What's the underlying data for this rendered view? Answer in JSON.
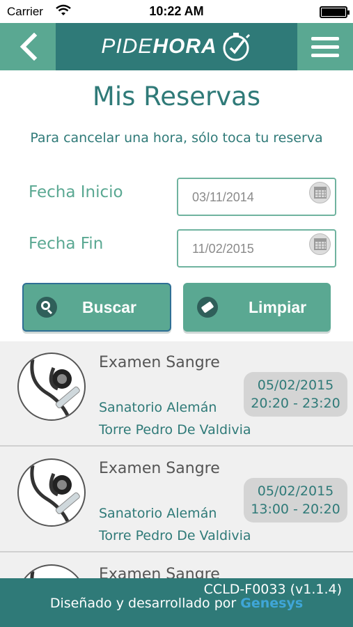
{
  "status_bar": {
    "carrier": "Carrier",
    "time": "10:22 AM"
  },
  "navbar": {
    "logo_part1": "PIDE",
    "logo_part2": "HORA"
  },
  "page": {
    "title": "Mis Reservas",
    "instruction": "Para cancelar una hora, sólo toca tu reserva"
  },
  "form": {
    "start_label": "Fecha Inicio",
    "start_value": "03/11/2014",
    "end_label": "Fecha Fin",
    "end_value": "11/02/2015"
  },
  "buttons": {
    "search": "Buscar",
    "clear": "Limpiar"
  },
  "reservations": [
    {
      "title": "Examen Sangre",
      "place": "Sanatorio Alemán",
      "branch": "Torre Pedro De Valdivia",
      "date": "05/02/2015",
      "time": "20:20 - 23:20"
    },
    {
      "title": "Examen Sangre",
      "place": "Sanatorio Alemán",
      "branch": "Torre Pedro De Valdivia",
      "date": "05/02/2015",
      "time": "13:00 - 20:20"
    },
    {
      "title": "Examen Sangre"
    }
  ],
  "footer": {
    "version": "CCLD-F0033 (v1.1.4)",
    "credit": "Diseñado y desarrollado por",
    "brand": "Genesys"
  }
}
